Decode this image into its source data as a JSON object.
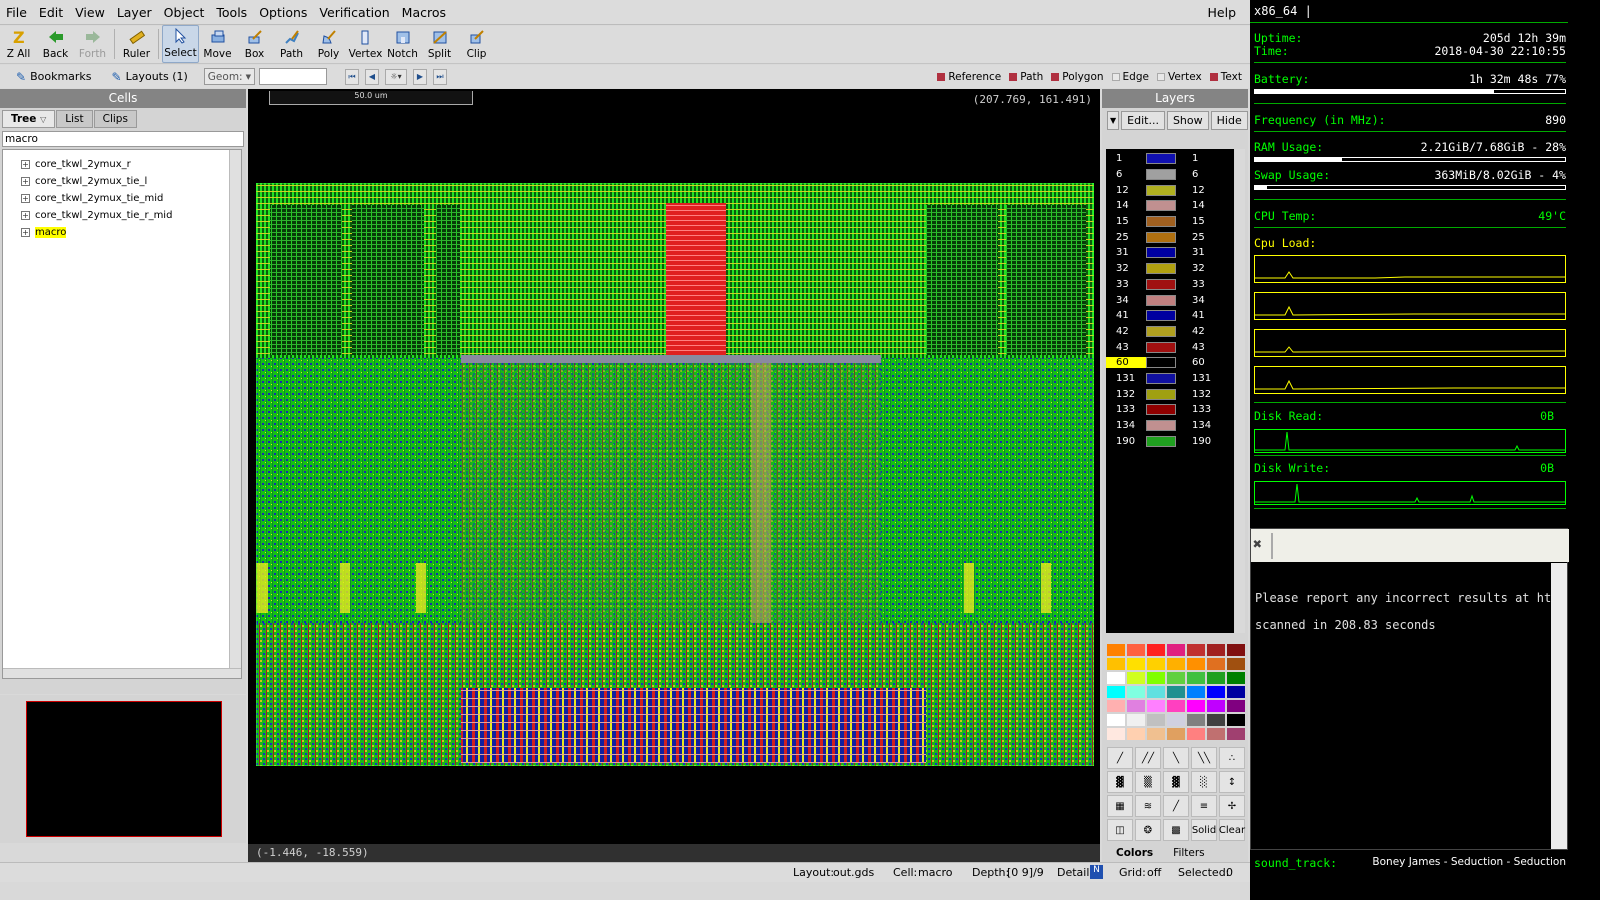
{
  "menu": {
    "items": [
      "File",
      "Edit",
      "View",
      "Layer",
      "Object",
      "Tools",
      "Options",
      "Verification",
      "Macros"
    ],
    "help": "Help"
  },
  "toolbar": {
    "tools": [
      {
        "label": "Z All",
        "icon": "zoom-fit-icon"
      },
      {
        "label": "Back",
        "icon": "back-arrow-icon"
      },
      {
        "label": "Forth",
        "icon": "forward-arrow-icon"
      },
      {
        "label": "Ruler",
        "icon": "ruler-icon"
      },
      {
        "label": "Select",
        "icon": "select-cursor-icon"
      },
      {
        "label": "Move",
        "icon": "move-icon"
      },
      {
        "label": "Box",
        "icon": "box-icon"
      },
      {
        "label": "Path",
        "icon": "path-icon"
      },
      {
        "label": "Poly",
        "icon": "polygon-icon"
      },
      {
        "label": "Vertex",
        "icon": "vertex-icon"
      },
      {
        "label": "Notch",
        "icon": "notch-icon"
      },
      {
        "label": "Split",
        "icon": "split-icon"
      },
      {
        "label": "Clip",
        "icon": "clip-icon"
      }
    ],
    "bookmarks": "Bookmarks",
    "layouts": "Layouts (1)",
    "geom": "Geom:",
    "legend": [
      "Reference",
      "Path",
      "Polygon",
      "Edge",
      "Vertex",
      "Text"
    ]
  },
  "cells": {
    "title": "Cells",
    "tabs": [
      "Tree",
      "List",
      "Clips"
    ],
    "filter": "macro",
    "items": [
      "core_tkwl_2ymux_r",
      "core_tkwl_2ymux_tie_l",
      "core_tkwl_2ymux_tie_mid",
      "core_tkwl_2ymux_tie_r_mid",
      "macro"
    ]
  },
  "canvas": {
    "ruler": "50.0 um",
    "coords_top": "(207.769, 161.491)",
    "coords_bottom": "(-1.446, -18.559)"
  },
  "layers": {
    "title": "Layers",
    "buttons": [
      "Edit...",
      "Show",
      "Hide"
    ],
    "rows": [
      {
        "n": "1",
        "color": "#1010b0"
      },
      {
        "n": "6",
        "color": "#a0a0a0"
      },
      {
        "n": "12",
        "color": "#b0b020"
      },
      {
        "n": "14",
        "color": "#c09090"
      },
      {
        "n": "15",
        "color": "#a06020"
      },
      {
        "n": "25",
        "color": "#b07010"
      },
      {
        "n": "31",
        "color": "#0000a0"
      },
      {
        "n": "32",
        "color": "#b0a010"
      },
      {
        "n": "33",
        "color": "#a01010"
      },
      {
        "n": "34",
        "color": "#c08080"
      },
      {
        "n": "41",
        "color": "#0000a0"
      },
      {
        "n": "42",
        "color": "#b0a020"
      },
      {
        "n": "43",
        "color": "#a01010"
      },
      {
        "n": "60",
        "color": "#000000"
      },
      {
        "n": "131",
        "color": "#1010a0"
      },
      {
        "n": "132",
        "color": "#a0a010"
      },
      {
        "n": "133",
        "color": "#900000"
      },
      {
        "n": "134",
        "color": "#c09090"
      },
      {
        "n": "190",
        "color": "#20a020"
      }
    ],
    "selected": "60",
    "tabs": [
      "Colors",
      "Filters"
    ],
    "solid": "Solid",
    "clear": "Clear"
  },
  "status": {
    "layout_label": "Layout:",
    "layout": "out.gds",
    "cell_label": "Cell:",
    "cell": "macro",
    "depth_label": "Depth:",
    "depth": "[0 9]/9",
    "detail_label": "Detail:",
    "grid_label": "Grid:",
    "grid": "off",
    "selected_label": "Selected:",
    "selected": "0"
  },
  "conky": {
    "terminal_title": "x86_64 |",
    "uptime_label": "Uptime:",
    "uptime": "205d 12h 39m",
    "time_label": "Time:",
    "time": "2018-04-30 22:10:55",
    "battery_label": "Battery:",
    "battery": "1h 32m 48s  77%",
    "battery_level": 0.77,
    "freq_label": "Frequency (in MHz):",
    "freq": "890",
    "ram_label": "RAM Usage:",
    "ram": "2.21GiB/7.68GiB - 28%",
    "ram_level": 0.28,
    "swap_label": "Swap Usage:",
    "swap": "363MiB/8.02GiB - 4%",
    "swap_level": 0.04,
    "cpu_temp_label": "CPU Temp:",
    "cpu_temp": "49'C",
    "cpu_load_label": "Cpu Load:",
    "disk_read_label": "Disk Read:",
    "disk_read": "0B",
    "disk_write_label": "Disk Write:",
    "disk_write": "0B",
    "term_line1": "Please report any incorrect results at http",
    "term_line2": "scanned in 208.83 seconds",
    "sound_label": "sound_track:",
    "sound": "Boney James - Seduction - Seduction"
  },
  "colors": {
    "layout_green": "#18e018",
    "layout_red": "#e02020",
    "layout_yellow": "#e8e820",
    "layout_blue": "#1828c0",
    "conky_green": "#00ff00",
    "conky_yellow": "#ffff00"
  }
}
